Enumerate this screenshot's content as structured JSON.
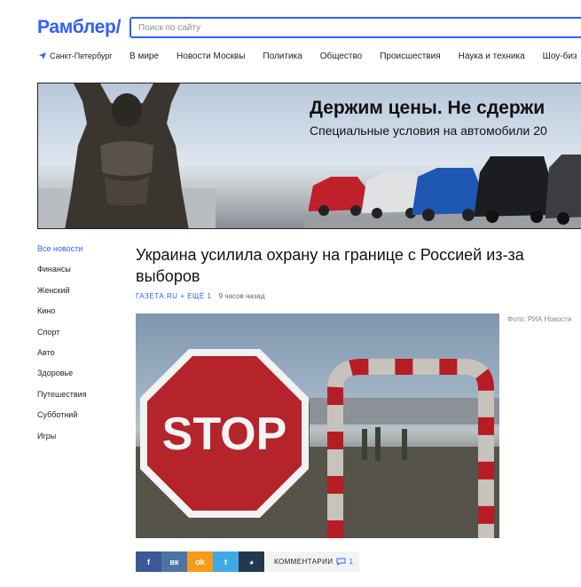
{
  "header": {
    "logo": "Рамблер/",
    "search_placeholder": "Поиск по сайту",
    "city": "Санкт-Петербург",
    "nav": [
      "В мире",
      "Новости Москвы",
      "Политика",
      "Общество",
      "Происшествия",
      "Наука и техника",
      "Шоу-биз"
    ]
  },
  "banner": {
    "headline": "Держим цены. Не сдержи",
    "subline": "Специальные условия на автомобили 20"
  },
  "sidebar": {
    "items": [
      {
        "label": "Все новости",
        "active": true
      },
      {
        "label": "Финансы"
      },
      {
        "label": "Женский"
      },
      {
        "label": "Кино"
      },
      {
        "label": "Спорт"
      },
      {
        "label": "Авто"
      },
      {
        "label": "Здоровье"
      },
      {
        "label": "Путешествия"
      },
      {
        "label": "Субботний"
      },
      {
        "label": "Игры"
      }
    ]
  },
  "article": {
    "title": "Украина усилила охрану на границе с Россией из-за выборов",
    "source": "ГАЗЕТА.RU + ЕЩЁ 1",
    "time": "9 часов назад",
    "photo_credit": "Фото: РИА Новости",
    "photo_sign": "STOP"
  },
  "share": {
    "buttons": [
      {
        "icon": "facebook-icon",
        "glyph": "f",
        "color": "#3b5998"
      },
      {
        "icon": "vk-icon",
        "glyph": "вк",
        "color": "#4c75a3"
      },
      {
        "icon": "odnoklassniki-icon",
        "glyph": "ok",
        "color": "#f59a1b"
      },
      {
        "icon": "twitter-icon",
        "glyph": "t",
        "color": "#3fa9e6"
      },
      {
        "icon": "livejournal-icon",
        "glyph": "◕",
        "color": "#22394d"
      }
    ],
    "comments_label": "КОММЕНТАРИИ",
    "comments_count": "1"
  }
}
